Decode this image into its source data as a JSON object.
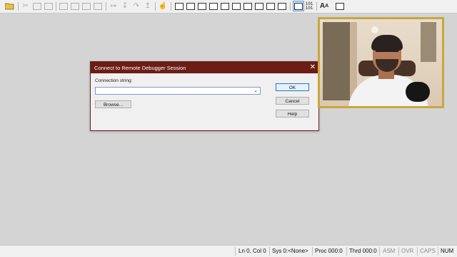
{
  "toolbar": {
    "icons": [
      "open-folder-icon",
      "cut-icon",
      "copy-icon",
      "paste-icon",
      "undo-icon",
      "restart-icon",
      "stop-debugging-icon",
      "detach-icon",
      "break-icon",
      "go-icon",
      "step-into-icon",
      "step-over-icon",
      "step-out-icon",
      "run-to-cursor-icon",
      "hand-icon",
      "command-window-icon",
      "watch-window-icon",
      "locals-window-icon",
      "registers-window-icon",
      "memory-window-icon",
      "call-stack-window-icon",
      "disassembly-window-icon",
      "scratch-pad-icon",
      "processes-threads-icon",
      "source-mode-icon",
      "hex-display-icon",
      "font-icon",
      "options-icon"
    ],
    "hex_label": "101\n101",
    "font_label": "A",
    "source_pressed": true
  },
  "dialog": {
    "title": "Connect to Remote Debugger Session",
    "close_glyph": "✕",
    "connection_label": "Connection string:",
    "connection_value": "",
    "ok_label": "OK",
    "cancel_label": "Cancel",
    "help_label": "Help",
    "browse_label": "Browse...",
    "title_bar_color": "#6b1d16"
  },
  "statusbar": {
    "position": "Ln 0, Col 0",
    "sys": "Sys 0:<None>",
    "proc": "Proc 000:0",
    "thrd": "Thrd 000:0",
    "asm": "ASM",
    "ovr": "OVR",
    "caps": "CAPS",
    "num": "NUM"
  },
  "webcam": {
    "frame_color": "#c9a640"
  }
}
